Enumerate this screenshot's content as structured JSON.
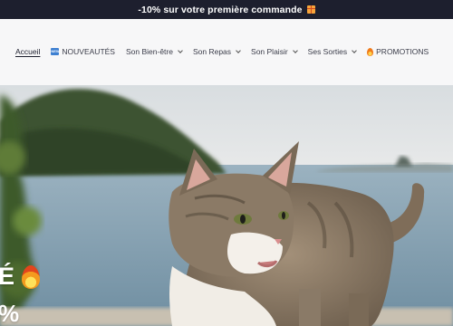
{
  "announcement": {
    "text": "-10% sur votre première commande",
    "icon": "gift-icon"
  },
  "nav": {
    "items": [
      {
        "label": "Accueil",
        "active": true,
        "dropdown": false
      },
      {
        "label": "NOUVEAUTÉS",
        "icon": "new-badge-icon",
        "dropdown": false
      },
      {
        "label": "Son Bien-être",
        "dropdown": true
      },
      {
        "label": "Son Repas",
        "dropdown": true
      },
      {
        "label": "Son Plaisir",
        "dropdown": true
      },
      {
        "label": "Ses Sorties",
        "dropdown": true
      },
      {
        "label": "PROMOTIONS",
        "icon": "flame-icon",
        "dropdown": false
      }
    ]
  },
  "hero": {
    "line1": "É",
    "line1_icon": "fire-icon",
    "line2": "%"
  },
  "colors": {
    "announcement_bg": "#1d1f2e",
    "header_bg": "#f7f7f8",
    "nav_text": "#3b3d4a"
  }
}
